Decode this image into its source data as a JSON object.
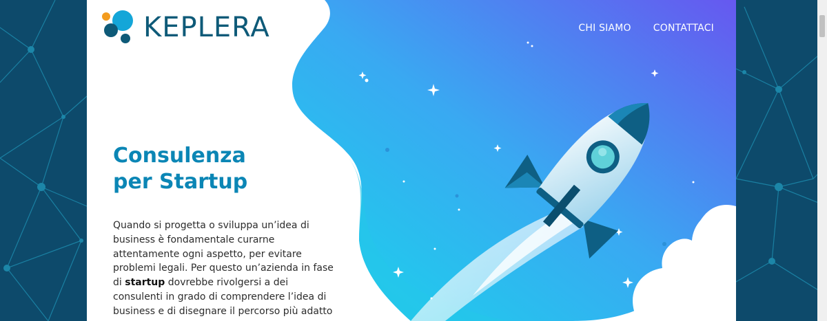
{
  "brand": {
    "name": "KEPLERA",
    "colors": {
      "primary": "#0e5a78",
      "accent": "#f39c1f",
      "cyan": "#14a6d8"
    }
  },
  "nav": {
    "items": [
      {
        "label": "CHI SIAMO"
      },
      {
        "label": "CONTATTACI"
      }
    ]
  },
  "hero": {
    "title_line1": "Consulenza",
    "title_line2": "per Startup",
    "paragraph_before": "Quando si progetta o sviluppa un’idea di business è fondamentale curarne attentamente ogni aspetto, per evitare problemi legali. Per questo un’azienda in fase di ",
    "paragraph_bold": "startup",
    "paragraph_after": " dovrebbe rivolgersi a dei consulenti in grado di comprendere l’idea di business e di disegnare il percorso più adatto a questo scopo.",
    "illustration": "rocket-launch-illustration"
  }
}
